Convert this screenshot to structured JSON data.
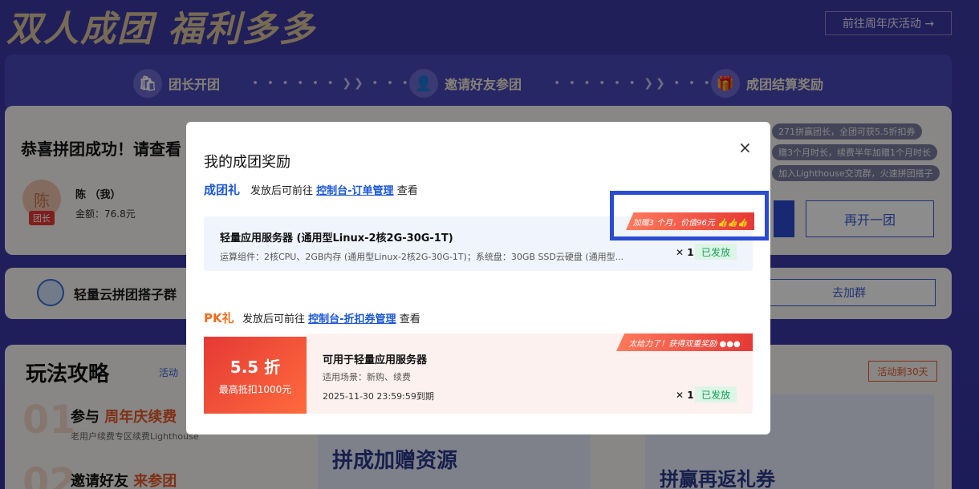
{
  "hero": {
    "title": "双人成团  福利多多",
    "activity_link": "前往周年庆活动 →"
  },
  "steps": [
    {
      "label": "团长开团",
      "icon": "bag-icon"
    },
    {
      "label": "邀请好友参团",
      "icon": "user-icon"
    },
    {
      "label": "成团结算奖励",
      "icon": "gift-icon"
    }
  ],
  "steps_connector": "• • • • • • ❯❯ • • • • • •",
  "group_card": {
    "congrats": "恭喜拼团成功！请查看",
    "avatar_char": "陈",
    "leader_tag": "团长",
    "member_name": "陈 （我）",
    "amount": "金额：76.8元",
    "open_again": "再开一团",
    "notes": [
      "271拼赢团长，全团可获5.5折扣券",
      "赠3个月时长，续费半年加赠1个月时长",
      "加入Lighthouse交流群，火速拼团搭子"
    ]
  },
  "group_chat_card": {
    "title": "轻量云拼团搭子群",
    "join_button": "去加群"
  },
  "guide_card": {
    "title": "玩法攻略",
    "subtitle": "活动",
    "days_badge": "活动剩30天",
    "step1_num": "01",
    "step1_title_a": "参与 ",
    "step1_title_b": "周年庆续费",
    "step1_desc": "老用户续费专区续费Lighthouse",
    "step2_num": "02",
    "step2_title_a": "邀请好友 ",
    "step2_title_b": "来参团",
    "promo1": "拼成加赠资源",
    "promo2": "拼赢再返礼券"
  },
  "modal": {
    "title": "我的成团奖励",
    "close_glyph": "×",
    "group_gift": {
      "label": "成团礼",
      "desc_prefix": "发放后可前往",
      "link": "控制台-订单管理",
      "desc_suffix": "查看",
      "bonus_ribbon": "加赠3 个月，价值96元 👍👍👍",
      "item_name": "轻量应用服务器 (通用型Linux-2核2G-30G-1T)",
      "item_spec": "运算组件：2核CPU、2GB内存 (通用型Linux-2核2G-30G-1T)；系统盘：30GB SSD云硬盘 (通用型...",
      "qty": "✕ 1",
      "status": "已发放"
    },
    "pk_gift": {
      "label": "PK礼",
      "desc_prefix": "发放后可前往",
      "link": "控制台-折扣券管理",
      "desc_suffix": "查看",
      "ribbon": "太给力了！获得双重奖励 ●●●",
      "discount": "5.5 折",
      "max_off": "最高抵扣1000元",
      "title": "可用于轻量应用服务器",
      "scene": "适用场景：新购、续费",
      "expiry": "2025-11-30 23:59:59到期",
      "qty": "✕ 1",
      "status": "已发放"
    }
  }
}
